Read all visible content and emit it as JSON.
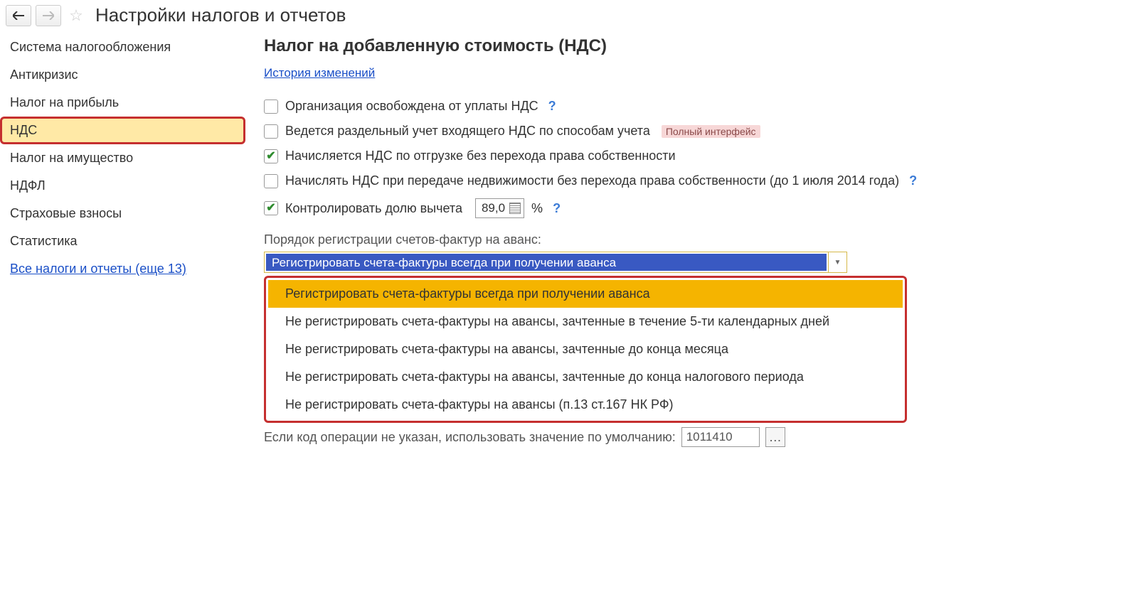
{
  "header": {
    "title": "Настройки налогов и отчетов"
  },
  "sidebar": {
    "items": [
      "Система налогообложения",
      "Антикризис",
      "Налог на прибыль",
      "НДС",
      "Налог на имущество",
      "НДФЛ",
      "Страховые взносы",
      "Статистика"
    ],
    "link": "Все налоги и отчеты (еще 13)"
  },
  "main": {
    "title": "Налог на добавленную стоимость (НДС)",
    "history": "История изменений",
    "cb1": "Организация освобождена от уплаты НДС",
    "cb2": "Ведется раздельный учет входящего НДС по способам учета",
    "badge": "Полный интерфейс",
    "cb3": "Начисляется НДС по отгрузке без перехода права собственности",
    "cb4": "Начислять НДС при передаче недвижимости без перехода права собственности (до 1 июля 2014 года)",
    "cb5": "Контролировать долю вычета",
    "percent_value": "89,0",
    "percent_sign": "%",
    "combo_label": "Порядок регистрации счетов-фактур на аванс:",
    "combo_value": "Регистрировать счета-фактуры всегда при получении аванса",
    "options": [
      "Регистрировать счета-фактуры всегда при получении аванса",
      "Не регистрировать счета-фактуры на авансы, зачтенные в течение 5-ти календарных дней",
      "Не регистрировать счета-фактуры на авансы, зачтенные до конца месяца",
      "Не регистрировать счета-фактуры на авансы, зачтенные до конца налогового периода",
      "Не регистрировать счета-фактуры на авансы (п.13 ст.167 НК РФ)"
    ],
    "default_label": "Если код операции не указан, использовать значение по умолчанию:",
    "default_value": "1011410",
    "help": "?"
  }
}
